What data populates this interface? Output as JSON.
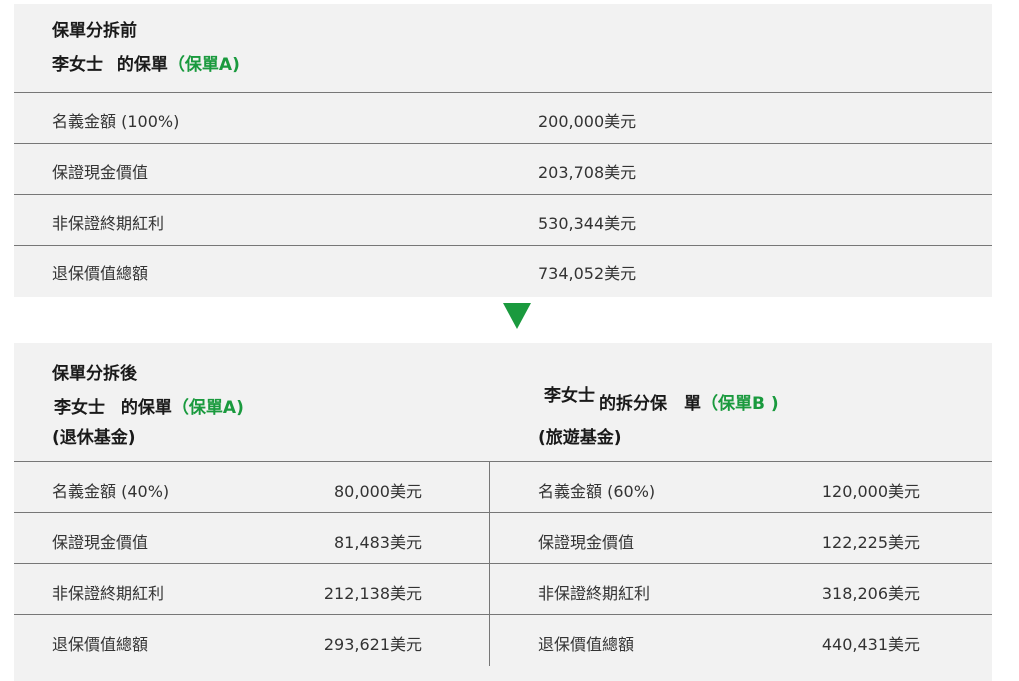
{
  "before": {
    "heading": "保單分拆前",
    "owner": "李女士",
    "policy_of": "的保單",
    "policy_tag": "（保單A)",
    "rows": [
      {
        "label": "名義金額 (100%)",
        "value": "200,000美元"
      },
      {
        "label": "保證現金價值",
        "value": "203,708美元"
      },
      {
        "label": "非保證終期紅利",
        "value": "530,344美元"
      },
      {
        "label": "退保價值總額",
        "value": "734,052美元"
      }
    ]
  },
  "after": {
    "heading": "保單分拆後",
    "left": {
      "owner": "李女士",
      "policy_of": "的保單",
      "policy_tag": "（保單A)",
      "fund": "(退休基金)",
      "rows": [
        {
          "label": "名義金額 (40%)",
          "value": "80,000美元"
        },
        {
          "label": "保證現金價值",
          "value": "81,483美元"
        },
        {
          "label": "非保證終期紅利",
          "value": "212,138美元"
        },
        {
          "label": "退保價值總額",
          "value": "293,621美元"
        }
      ]
    },
    "right": {
      "owner": "李女士",
      "policy_of": "的拆分保　單",
      "policy_tag": "（保單B )",
      "fund": "(旅遊基金)",
      "rows": [
        {
          "label": "名義金額 (60%)",
          "value": "120,000美元"
        },
        {
          "label": "保證現金價值",
          "value": "122,225美元"
        },
        {
          "label": "非保證終期紅利",
          "value": "318,206美元"
        },
        {
          "label": "退保價值總額",
          "value": "440,431美元"
        }
      ]
    }
  },
  "colors": {
    "accent": "#1a9a3e",
    "panel": "#f2f2f2",
    "rule": "#777777"
  },
  "icons": {
    "divider_arrow": "down-triangle-icon"
  }
}
